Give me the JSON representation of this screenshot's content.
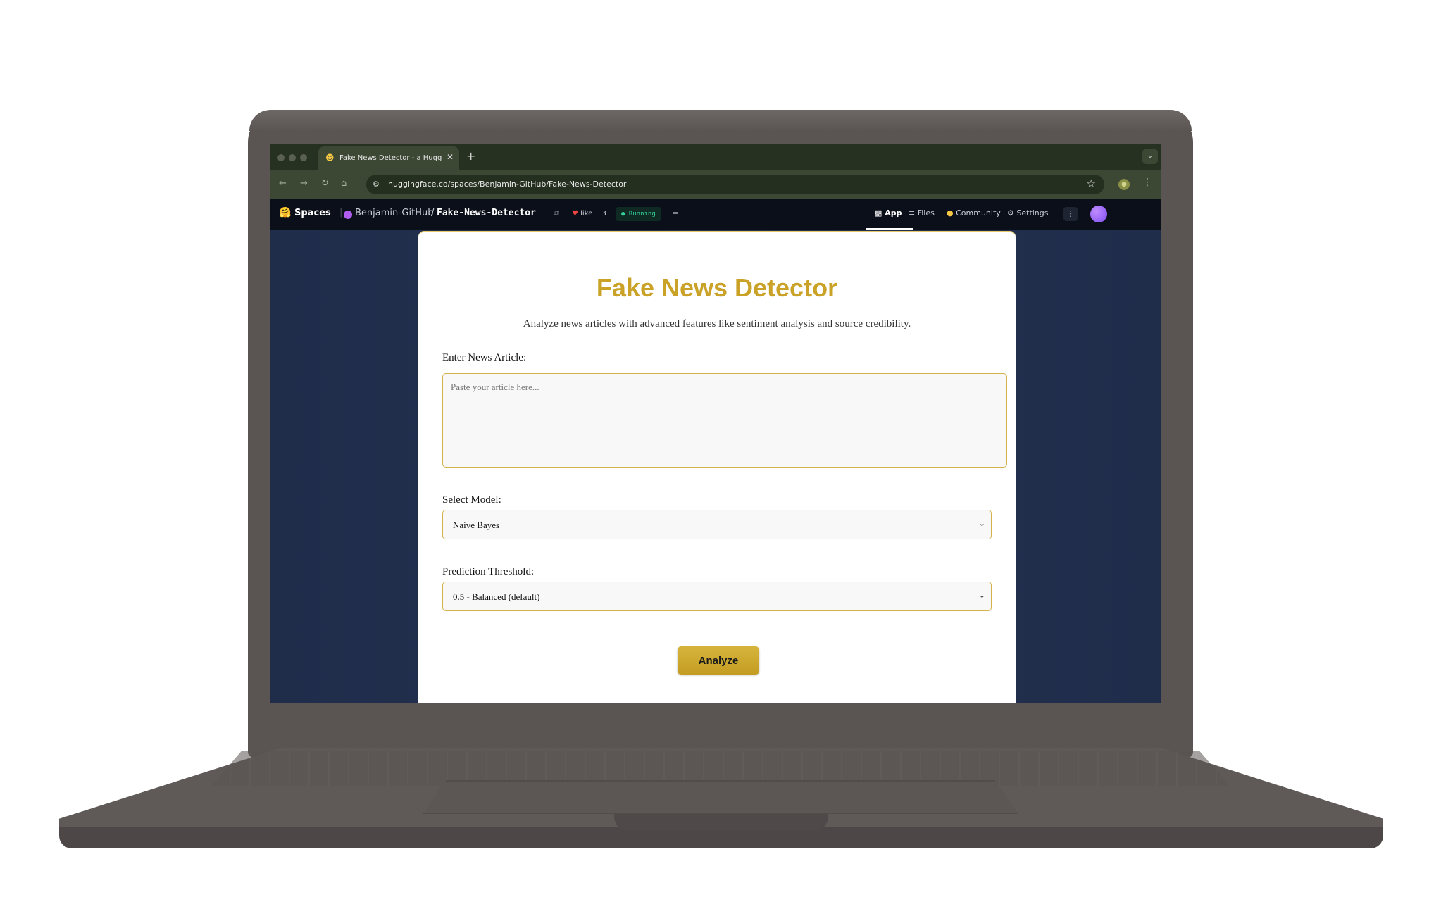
{
  "browser": {
    "tab_title": "Fake News Detector - a Hugg",
    "tab_favicon": "hugging-face-emoji",
    "url": "huggingface.co/spaces/Benjamin-GitHub/Fake-News-Detector"
  },
  "hf_header": {
    "spaces_label": "Spaces",
    "owner": "Benjamin-GitHub",
    "separator": "/",
    "repo": "Fake-News-Detector",
    "like_label": "like",
    "like_count": "3",
    "status": "Running",
    "nav": [
      {
        "label": "App",
        "icon": "cube-icon",
        "active": true
      },
      {
        "label": "Files",
        "icon": "files-icon",
        "active": false
      },
      {
        "label": "Community",
        "icon": "community-icon",
        "active": false
      },
      {
        "label": "Settings",
        "icon": "gear-icon",
        "active": false
      }
    ]
  },
  "app": {
    "title": "Fake News Detector",
    "subtitle": "Analyze news articles with advanced features like sentiment analysis and source credibility.",
    "article_label": "Enter News Article:",
    "article_placeholder": "Paste your article here...",
    "model_label": "Select Model:",
    "model_value": "Naive Bayes",
    "threshold_label": "Prediction Threshold:",
    "threshold_value": "0.5 - Balanced (default)",
    "analyze_label": "Analyze"
  },
  "colors": {
    "accent_gold": "#c9a227",
    "page_bg": "#1f2b47",
    "hf_header_bg": "#0b0f19",
    "running_green": "#34d399"
  }
}
